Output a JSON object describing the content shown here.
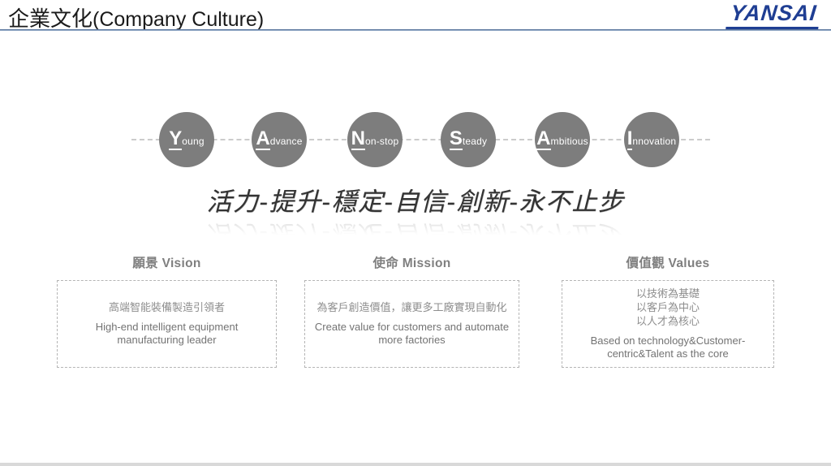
{
  "header": {
    "title_zh": "企業文化",
    "title_en": "(Company Culture)",
    "logo": "YANSAI"
  },
  "circles": [
    {
      "initial": "Y",
      "rest": "oung"
    },
    {
      "initial": "A",
      "rest": "dvance"
    },
    {
      "initial": "N",
      "rest": "on-stop"
    },
    {
      "initial": "S",
      "rest": "teady"
    },
    {
      "initial": "A",
      "rest": "mbitious"
    },
    {
      "initial": "I",
      "rest": "nnovation"
    }
  ],
  "slogan": "活力-提升-穩定-自信-創新-永不止步",
  "sections": [
    {
      "title": "願景 Vision",
      "body_zh": [
        "高端智能裝備製造引領者"
      ],
      "body_en": "High-end intelligent equipment manufacturing leader"
    },
    {
      "title": "使命 Mission",
      "body_zh": [
        "為客戶創造價值，讓更多工廠實現自動化"
      ],
      "body_en": "Create value for customers and automate more factories"
    },
    {
      "title": "價值觀 Values",
      "body_zh": [
        "以技術為基礎",
        "以客戶為中心",
        "以人才為核心"
      ],
      "body_en": "Based on technology&Customer-centric&Talent as the core"
    }
  ],
  "colors": {
    "logo_blue": "#1f3e93",
    "header_rule_blue": "#44618c",
    "circle_gray": "#7d7d7d",
    "section_text_gray": "#7f7f7f",
    "box_border_gray": "#b5b5b5",
    "bottom_bar_gray": "#d9d9d9"
  }
}
